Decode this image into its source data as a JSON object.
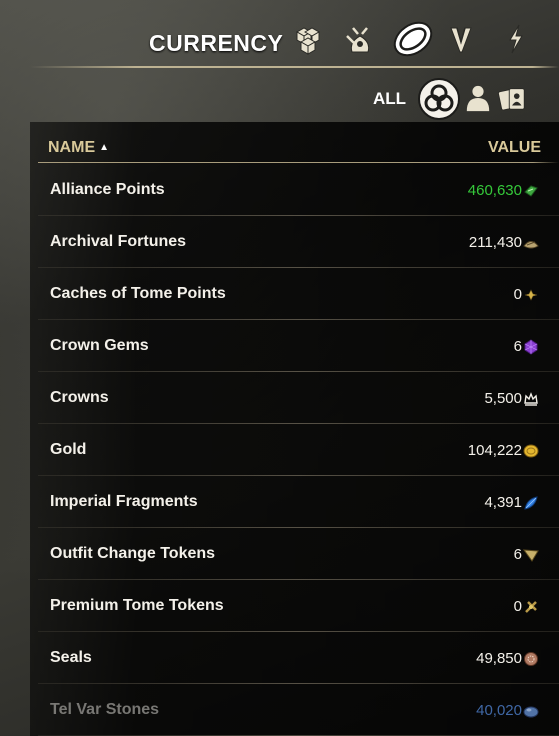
{
  "header": {
    "title": "CURRENCY",
    "category_icons": [
      "treasure-chests-icon",
      "crafting-bag-icon",
      "currency-icon",
      "pledge-icon",
      "energy-icon"
    ],
    "active_category": "currency-icon"
  },
  "filters": {
    "all_label": "ALL",
    "icons": [
      "all-filter-icon",
      "character-filter-icon",
      "account-filter-icon"
    ],
    "active": "all-filter-icon"
  },
  "columns": {
    "name": "NAME",
    "value": "VALUE",
    "sort_arrow": "▲"
  },
  "rows": [
    {
      "name": "Alliance Points",
      "value": "460,630",
      "icon": "alliance-points-icon",
      "value_color": "#35c93a"
    },
    {
      "name": "Archival Fortunes",
      "value": "211,430",
      "icon": "archival-fortunes-icon",
      "value_color": "#f4f1ea"
    },
    {
      "name": "Caches of Tome Points",
      "value": "0",
      "icon": "tome-points-icon",
      "value_color": "#f4f1ea"
    },
    {
      "name": "Crown Gems",
      "value": "6",
      "icon": "crown-gem-icon",
      "value_color": "#f4f1ea"
    },
    {
      "name": "Crowns",
      "value": "5,500",
      "icon": "crown-icon",
      "value_color": "#f4f1ea"
    },
    {
      "name": "Gold",
      "value": "104,222",
      "icon": "gold-coin-icon",
      "value_color": "#f4f1ea"
    },
    {
      "name": "Imperial Fragments",
      "value": "4,391",
      "icon": "imperial-fragment-icon",
      "value_color": "#f4f1ea"
    },
    {
      "name": "Outfit Change Tokens",
      "value": "6",
      "icon": "outfit-token-icon",
      "value_color": "#f4f1ea"
    },
    {
      "name": "Premium Tome Tokens",
      "value": "0",
      "icon": "tome-token-icon",
      "value_color": "#f4f1ea"
    },
    {
      "name": "Seals",
      "value": "49,850",
      "icon": "seal-icon",
      "value_color": "#f4f1ea"
    },
    {
      "name": "Tel Var Stones",
      "value": "40,020",
      "icon": "tel-var-stone-icon",
      "value_color": "#4a79c2"
    }
  ]
}
